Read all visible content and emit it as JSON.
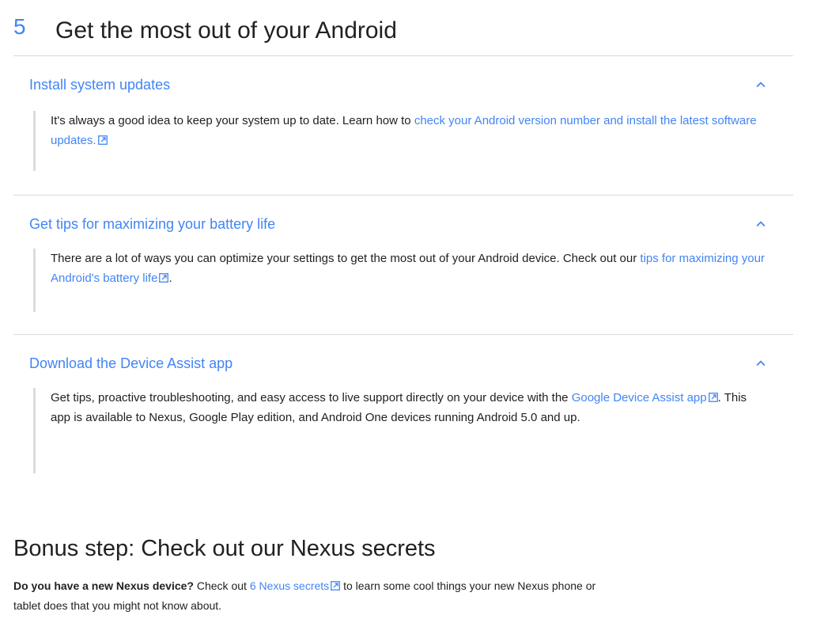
{
  "step": {
    "number": "5",
    "title": "Get the most out of your Android"
  },
  "sections": [
    {
      "title": "Install system updates",
      "icon": "chevron-up-icon",
      "text_before": "It's always a good idea to keep your system up to date. Learn how to ",
      "link_text": "check your Android version number and install the latest software updates.",
      "text_after": ""
    },
    {
      "title": "Get tips for maximizing your battery life",
      "icon": "chevron-up-icon",
      "text_before": "There are a lot of ways you can optimize your settings to get the most out of your Android device. Check out our ",
      "link_text": "tips for maximizing your Android's battery life",
      "text_after": "."
    },
    {
      "title": "Download the Device Assist app",
      "icon": "chevron-up-icon",
      "text_before": "Get tips, proactive troubleshooting, and easy access to live support directly on your device with the ",
      "link_text": "Google Device Assist app",
      "text_after": ". This app is available to Nexus, Google Play edition, and Android One devices running Android 5.0 and up."
    }
  ],
  "bonus": {
    "title": "Bonus step: Check out our Nexus secrets",
    "bold_text": "Do you have a new Nexus device?",
    "text_before": " Check out ",
    "link_text": "6 Nexus secrets",
    "text_after": " to learn some cool things your new Nexus phone or tablet does that you might not know about."
  },
  "colors": {
    "link": "#4285f4",
    "text": "#212121",
    "divider": "#dadada"
  }
}
